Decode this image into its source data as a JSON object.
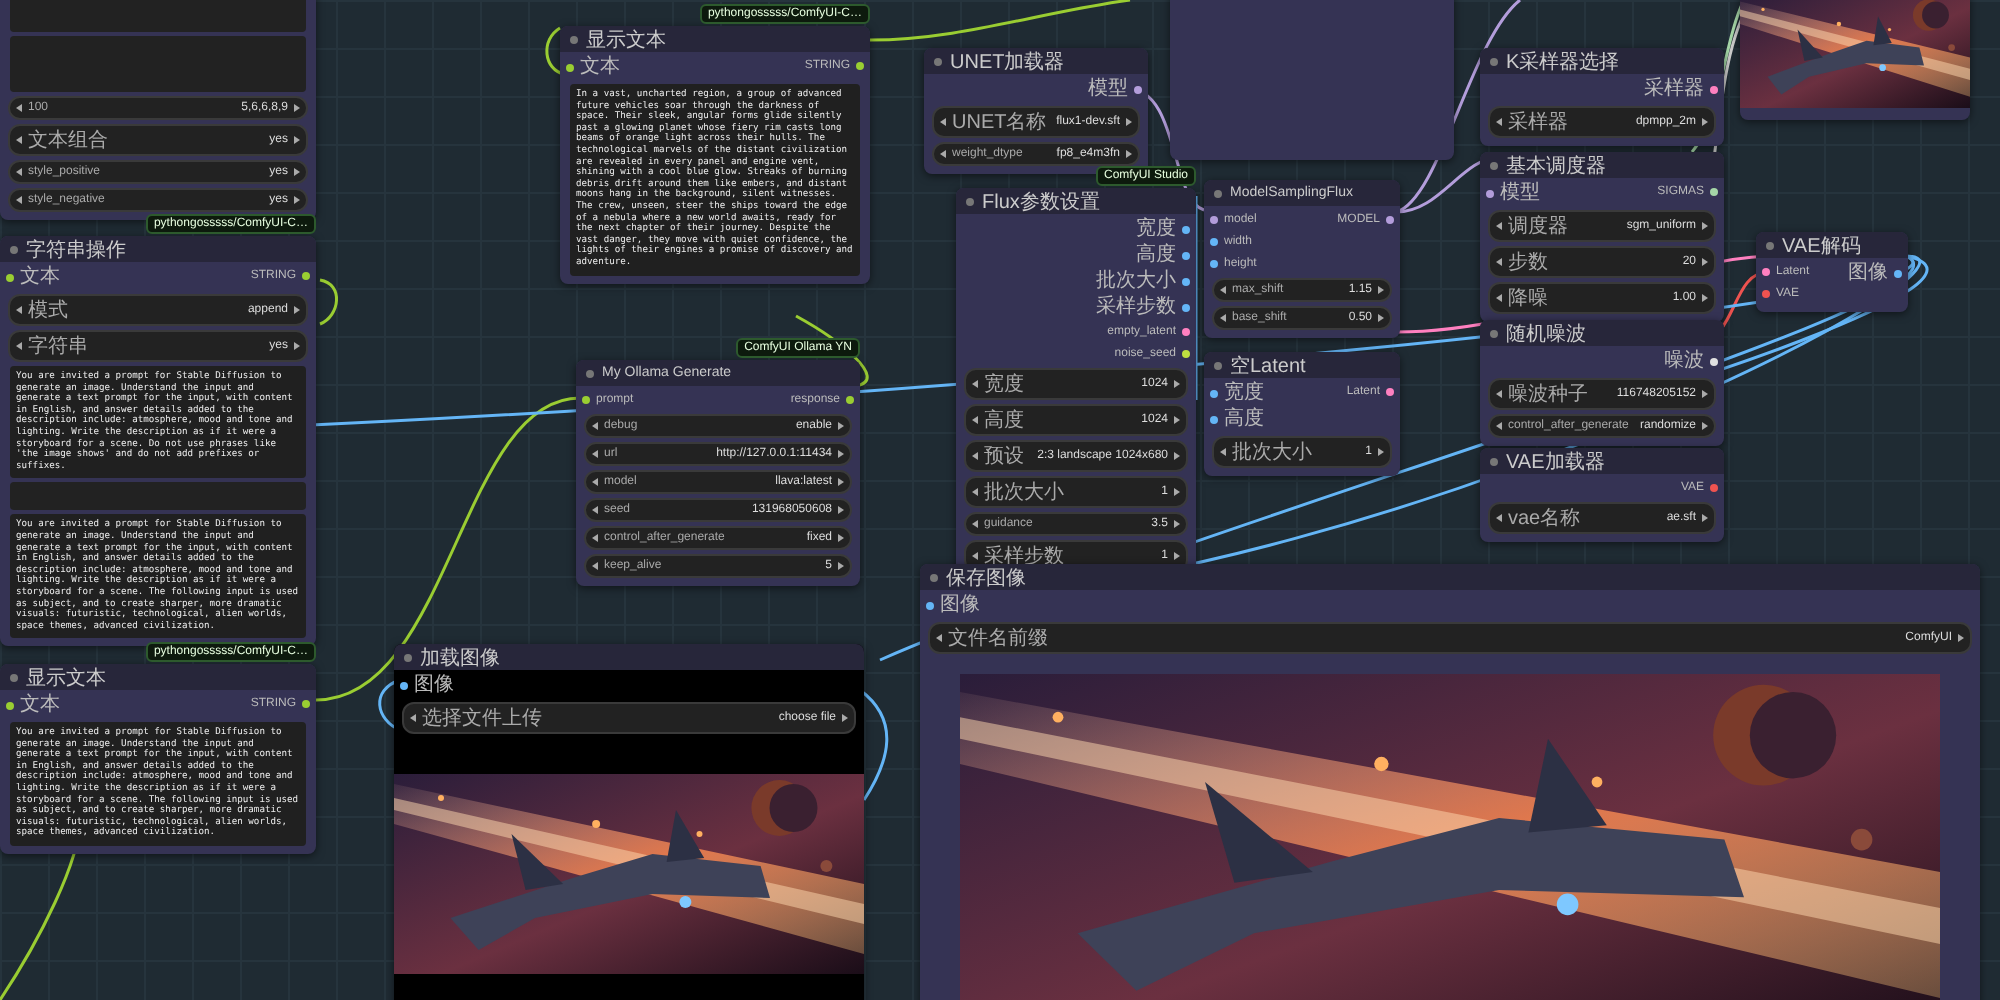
{
  "nodes": [
    {
      "kind": "node",
      "body": [
        {
          "kind": "blank"
        },
        {
          "kind": "blank"
        },
        {
          "kind": "widget",
          "label": "100",
          "value": "5,6,6,8,9"
        },
        {
          "kind": "widget",
          "label": "文本组合",
          "value": "yes"
        },
        {
          "kind": "widget",
          "label": "style_positive",
          "value": "yes"
        },
        {
          "kind": "widget",
          "label": "style_negative",
          "value": "yes"
        }
      ]
    },
    {
      "kind": "node",
      "title": "字符串操作",
      "badge": "pythongosssss/ComfyUI-C…",
      "inputs": [
        {
          "label": "文本",
          "color": "#9acd32"
        }
      ],
      "outputs": [
        {
          "label": "STRING",
          "color": "#9acd32"
        }
      ],
      "body": [
        {
          "kind": "widget",
          "label": "模式",
          "value": "append"
        },
        {
          "kind": "widget",
          "label": "字符串",
          "value": "yes"
        },
        {
          "kind": "text",
          "text": "You are invited a prompt for Stable Diffusion to generate an image. Understand the input and generate a text prompt for the input, with content in English, and answer details added to the description include: atmosphere, mood and tone and lighting. Write the description as if it were a storyboard for a scene. Do not use phrases like 'the image shows' and do not add prefixes or suffixes."
        },
        {
          "kind": "blank"
        },
        {
          "kind": "text",
          "text": "You are invited a prompt for Stable Diffusion to generate an image. Understand the input and generate a text prompt for the input, with content in English, and answer details added to the description include: atmosphere, mood and tone and lighting. Write the description as if it were a storyboard for a scene. The following input is used as subject, and to create sharper, more dramatic visuals: futuristic, technological, alien worlds, space themes, advanced civilization."
        }
      ]
    },
    {
      "kind": "node",
      "title": "显示文本",
      "badge": "pythongosssss/ComfyUI-C…",
      "inputs": [
        {
          "label": "文本",
          "color": "#9acd32"
        }
      ],
      "outputs": [
        {
          "label": "STRING",
          "color": "#9acd32"
        }
      ],
      "body": [
        {
          "kind": "text",
          "text": "You are invited a prompt for Stable Diffusion to generate an image. Understand the input and generate a text prompt for the input, with content in English, and answer details added to the description include: atmosphere, mood and tone and lighting. Write the description as if it were a storyboard for a scene. The following input is used as subject, and to create sharper, more dramatic visuals: futuristic, technological, alien worlds, space themes, advanced civilization."
        }
      ]
    },
    {
      "kind": "node",
      "title": "显示文本",
      "badge": "pythongosssss/ComfyUI-C…",
      "inputs": [
        {
          "label": "文本",
          "color": "#9acd32"
        }
      ],
      "outputs": [
        {
          "label": "STRING",
          "color": "#9acd32"
        }
      ],
      "body": [
        {
          "kind": "text",
          "text": "In a vast, uncharted region, a group of advanced future vehicles soar through the darkness of space. Their sleek, angular forms glide silently past a glowing planet whose fiery rim casts long beams of orange light across their hulls. The technological marvels of the distant civilization are revealed in every panel and engine vent, shining with a cool blue glow. Streaks of burning debris drift around them like embers, and distant moons hang in the background, silent witnesses. The crew, unseen, steer the ships toward the edge of a nebula where a new world awaits, ready for the next chapter of their journey. Despite the vast danger, they move with quiet confidence, the lights of their engines a promise of discovery and adventure."
        }
      ]
    },
    {
      "kind": "node",
      "title": "My Ollama Generate",
      "badge": "ComfyUI Ollama YN",
      "inputs": [
        {
          "label": "prompt",
          "color": "#9acd32"
        }
      ],
      "outputs": [
        {
          "label": "response",
          "color": "#9acd32"
        }
      ],
      "body": [
        {
          "kind": "widget",
          "label": "debug",
          "value": "enable"
        },
        {
          "kind": "widget",
          "label": "url",
          "value": "http://127.0.0.1:11434"
        },
        {
          "kind": "widget",
          "label": "model",
          "value": "llava:latest"
        },
        {
          "kind": "widget",
          "label": "seed",
          "value": "131968050608"
        },
        {
          "kind": "widget",
          "label": "control_after_generate",
          "value": "fixed"
        },
        {
          "kind": "widget",
          "label": "keep_alive",
          "value": "5"
        }
      ]
    },
    {
      "kind": "node",
      "title": "UNET加载器",
      "outputs": [
        {
          "label": "模型",
          "color": "#b39ddb"
        }
      ],
      "body": [
        {
          "kind": "widget",
          "label": "UNET名称",
          "value": "flux1-dev.sft"
        },
        {
          "kind": "widget",
          "label": "weight_dtype",
          "value": "fp8_e4m3fn"
        }
      ]
    },
    {
      "kind": "panel"
    },
    {
      "kind": "node",
      "title": "Flux参数设置",
      "badge": "ComfyUI Studio",
      "outputs": [
        {
          "label": "宽度",
          "color": "#64b5f6"
        },
        {
          "label": "高度",
          "color": "#64b5f6"
        },
        {
          "label": "批次大小",
          "color": "#64b5f6"
        },
        {
          "label": "采样步数",
          "color": "#64b5f6"
        },
        {
          "label": "empty_latent",
          "color": "#ff80c0"
        },
        {
          "label": "noise_seed",
          "color": "#c0e040"
        }
      ],
      "body": [
        {
          "kind": "widget",
          "label": "宽度",
          "value": "1024"
        },
        {
          "kind": "widget",
          "label": "高度",
          "value": "1024"
        },
        {
          "kind": "widget",
          "label": "预设",
          "value": "2:3 landscape 1024x680"
        },
        {
          "kind": "widget",
          "label": "批次大小",
          "value": "1"
        },
        {
          "kind": "widget",
          "label": "guidance",
          "value": "3.5"
        },
        {
          "kind": "widget",
          "label": "采样步数",
          "value": "1"
        }
      ]
    },
    {
      "kind": "node",
      "title": "ModelSamplingFlux",
      "inputs": [
        {
          "label": "model",
          "color": "#b39ddb"
        },
        {
          "label": "width",
          "color": "#64b5f6"
        },
        {
          "label": "height",
          "color": "#64b5f6"
        }
      ],
      "outputs": [
        {
          "label": "MODEL",
          "color": "#b39ddb"
        }
      ],
      "body": [
        {
          "kind": "widget",
          "label": "max_shift",
          "value": "1.15"
        },
        {
          "kind": "widget",
          "label": "base_shift",
          "value": "0.50"
        }
      ]
    },
    {
      "kind": "node",
      "title": "空Latent",
      "inputs": [
        {
          "label": "宽度",
          "color": "#64b5f6"
        },
        {
          "label": "高度",
          "color": "#64b5f6"
        }
      ],
      "outputs": [
        {
          "label": "Latent",
          "color": "#ff80c0"
        }
      ],
      "body": [
        {
          "kind": "widget",
          "label": "批次大小",
          "value": "1"
        }
      ]
    },
    {
      "kind": "node",
      "title": "K采样器选择",
      "outputs": [
        {
          "label": "采样器",
          "color": "#ff80c0"
        }
      ],
      "body": [
        {
          "kind": "widget",
          "label": "采样器",
          "value": "dpmpp_2m"
        }
      ]
    },
    {
      "kind": "node",
      "title": "基本调度器",
      "inputs": [
        {
          "label": "模型",
          "color": "#b39ddb"
        }
      ],
      "outputs": [
        {
          "label": "SIGMAS",
          "color": "#a5d6a7"
        }
      ],
      "body": [
        {
          "kind": "widget",
          "label": "调度器",
          "value": "sgm_uniform"
        },
        {
          "kind": "widget",
          "label": "步数",
          "value": "20"
        },
        {
          "kind": "widget",
          "label": "降噪",
          "value": "1.00"
        }
      ]
    },
    {
      "kind": "node",
      "title": "随机噪波",
      "outputs": [
        {
          "label": "噪波",
          "color": "#e0e0e0"
        }
      ],
      "body": [
        {
          "kind": "widget",
          "label": "噪波种子",
          "value": "116748205152"
        },
        {
          "kind": "widget",
          "label": "control_after_generate",
          "value": "randomize"
        }
      ]
    },
    {
      "kind": "node",
      "title": "VAE解码",
      "inputs": [
        {
          "label": "Latent",
          "color": "#ff80c0"
        },
        {
          "label": "VAE",
          "color": "#ef5350"
        }
      ],
      "outputs": [
        {
          "label": "图像",
          "color": "#64b5f6"
        }
      ]
    },
    {
      "kind": "node",
      "title": "VAE加载器",
      "outputs": [
        {
          "label": "VAE",
          "color": "#ef5350"
        }
      ],
      "body": [
        {
          "kind": "widget",
          "label": "vae名称",
          "value": "ae.sft"
        }
      ]
    },
    {
      "kind": "node",
      "body": [
        {
          "kind": "picture"
        }
      ]
    },
    {
      "kind": "node",
      "title": "保存图像",
      "inputs": [
        {
          "label": "图像",
          "color": "#64b5f6"
        }
      ],
      "body": [
        {
          "kind": "widget",
          "label": "文件名前缀",
          "value": "ComfyUI"
        },
        {
          "kind": "picture"
        }
      ]
    },
    {
      "kind": "node",
      "title": "加载图像",
      "inputs": [
        {
          "label": "图像",
          "color": "#64b5f6"
        }
      ],
      "body": [
        {
          "kind": "widget",
          "label": "选择文件上传",
          "value": "choose file"
        },
        {
          "kind": "picture"
        }
      ]
    }
  ]
}
